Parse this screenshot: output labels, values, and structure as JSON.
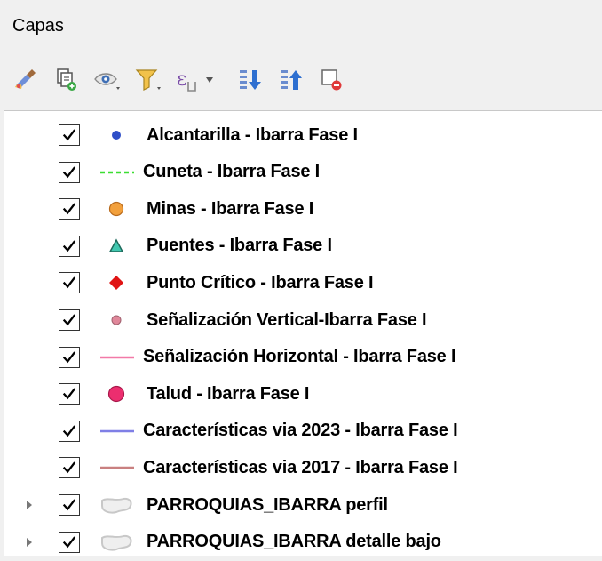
{
  "panel": {
    "title": "Capas"
  },
  "toolbar": {
    "buttons": [
      {
        "name": "style-manager-icon"
      },
      {
        "name": "add-group-icon"
      },
      {
        "name": "visibility-icon"
      },
      {
        "name": "filter-icon"
      },
      {
        "name": "expression-filter-icon"
      },
      {
        "name": "expand-all-icon"
      },
      {
        "name": "collapse-all-icon"
      },
      {
        "name": "remove-layer-icon"
      }
    ]
  },
  "layers": [
    {
      "label": "Alcantarilla - Ibarra Fase I",
      "checked": true,
      "symbol": "dot",
      "color": "#2f4fc8"
    },
    {
      "label": "Cuneta - Ibarra Fase I",
      "checked": true,
      "symbol": "dashed-line",
      "color": "#3cde32"
    },
    {
      "label": "Minas - Ibarra Fase I",
      "checked": true,
      "symbol": "circle",
      "color": "#f2a03c"
    },
    {
      "label": "Puentes - Ibarra Fase I",
      "checked": true,
      "symbol": "triangle",
      "color": "#42c8b0"
    },
    {
      "label": "Punto Crítico - Ibarra Fase I",
      "checked": true,
      "symbol": "diamond",
      "color": "#e01414"
    },
    {
      "label": "Señalización Vertical-Ibarra Fase I",
      "checked": true,
      "symbol": "small-dot",
      "color": "#e0879a"
    },
    {
      "label": "Señalización Horizontal - Ibarra Fase I",
      "checked": true,
      "symbol": "line",
      "color": "#f27aa8"
    },
    {
      "label": "Talud - Ibarra Fase I",
      "checked": true,
      "symbol": "big-circle",
      "color": "#ec2e6f"
    },
    {
      "label": "Características via 2023 - Ibarra Fase I",
      "checked": true,
      "symbol": "line",
      "color": "#7f7fe6"
    },
    {
      "label": "Características via 2017 - Ibarra Fase I",
      "checked": true,
      "symbol": "line",
      "color": "#c98080"
    },
    {
      "label": "PARROQUIAS_IBARRA perfil",
      "checked": true,
      "symbol": "polygon",
      "color": "#c8c8c8",
      "expandable": true
    },
    {
      "label": "PARROQUIAS_IBARRA detalle bajo",
      "checked": true,
      "symbol": "polygon",
      "color": "#c8c8c8",
      "expandable": true
    }
  ]
}
